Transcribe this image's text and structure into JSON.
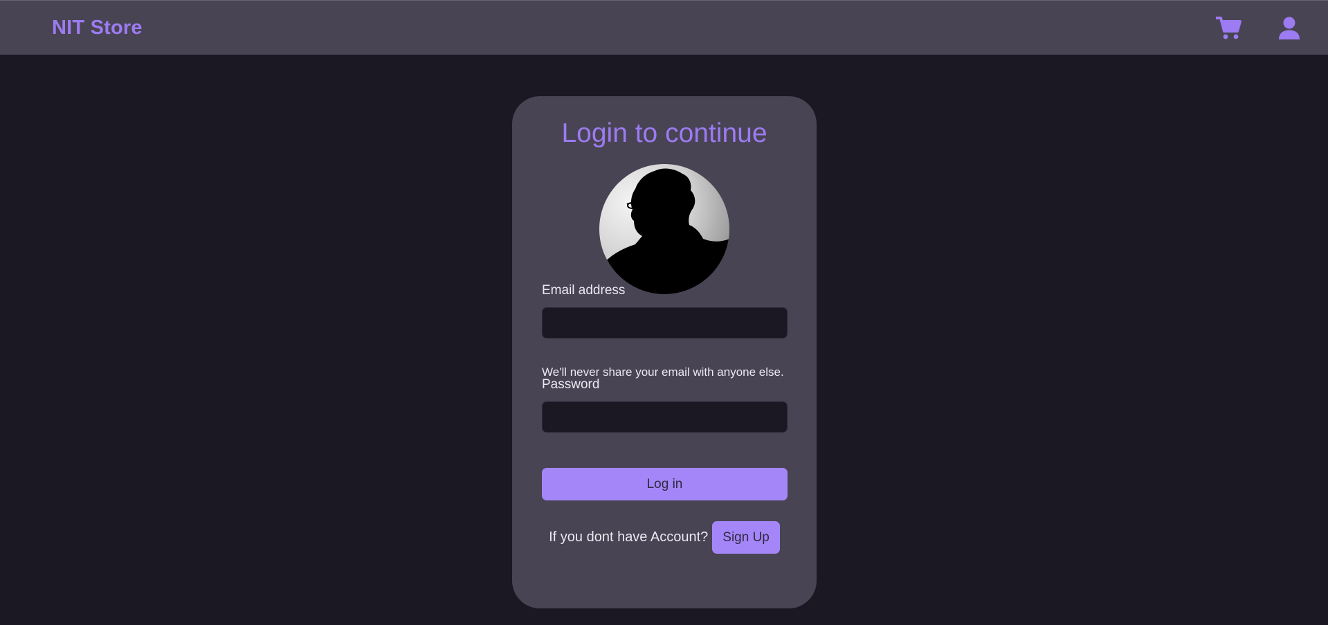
{
  "navbar": {
    "brand": "NIT Store",
    "cart_icon": "cart-icon",
    "user_icon": "user-icon"
  },
  "login": {
    "title": "Login to continue",
    "avatar_icon": "profile-silhouette",
    "email_label": "Email address",
    "email_value": "",
    "email_help": "We'll never share your email with anyone else.",
    "password_label": "Password",
    "password_value": "",
    "login_button": "Log in",
    "signup_prompt": "If you dont have Account?",
    "signup_button": "Sign Up"
  },
  "colors": {
    "accent": "#9d7bf2",
    "button": "#a586f8",
    "background": "#1b1824",
    "surface": "#484453"
  }
}
